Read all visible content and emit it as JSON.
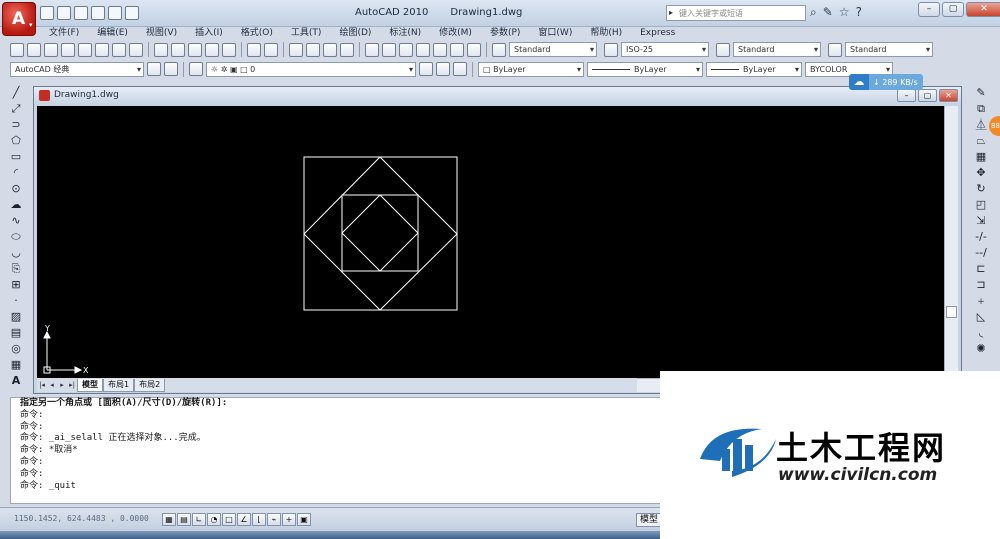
{
  "app": {
    "title": "AutoCAD 2010",
    "document": "Drawing1.dwg",
    "search_placeholder": "键入关键字或短语"
  },
  "menu": [
    "文件(F)",
    "编辑(E)",
    "视图(V)",
    "插入(I)",
    "格式(O)",
    "工具(T)",
    "绘图(D)",
    "标注(N)",
    "修改(M)",
    "参数(P)",
    "窗口(W)",
    "帮助(H)",
    "Express"
  ],
  "toolbar": {
    "text_style": "Standard",
    "dim_style": "ISO-25",
    "table_style": "Standard",
    "multileader_style": "Standard",
    "workspace": "AutoCAD 经典",
    "layer": "0",
    "color": "ByLayer",
    "linetype": "ByLayer",
    "lineweight": "ByLayer",
    "plotstyle": "BYCOLOR"
  },
  "drawing": {
    "window_title": "Drawing1.dwg",
    "tabs": [
      "模型",
      "布局1",
      "布局2"
    ],
    "ucs_x": "X",
    "ucs_y": "Y"
  },
  "command_lines": [
    "指定另一个角点或 [面积(A)/尺寸(D)/旋转(R)]:",
    "命令:",
    "命令:",
    "命令: _ai_selall 正在选择对象...完成。",
    "命令: *取消*",
    "命令:",
    "命令:",
    "命令: _quit"
  ],
  "status": {
    "coords": "1150.1452, 624.4483 , 0.0000",
    "model_label": "模型"
  },
  "overlay": {
    "net_speed": "289 KB/s",
    "orange_badge": "88"
  },
  "watermark": {
    "name": "土木工程网",
    "url": "www.civilcn.com"
  },
  "colors": {
    "canvas": "#000000",
    "geometry": "#ffffff",
    "app_button": "#c42d22",
    "watermark_blue": "#1f6fb8"
  }
}
